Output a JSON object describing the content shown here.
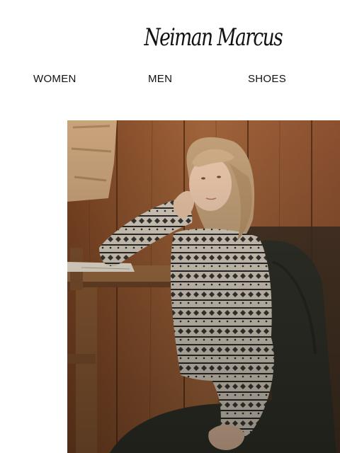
{
  "header": {
    "logo_text": "Neiman Marcus"
  },
  "nav": {
    "items": [
      {
        "label": "WOMEN"
      },
      {
        "label": "MEN"
      },
      {
        "label": "SHOES"
      }
    ]
  },
  "hero": {
    "image_subject": "fair-isle-sweater-model-photo"
  },
  "colors": {
    "background": "#ffffff",
    "text": "#111111",
    "wood": "#8a5230"
  }
}
